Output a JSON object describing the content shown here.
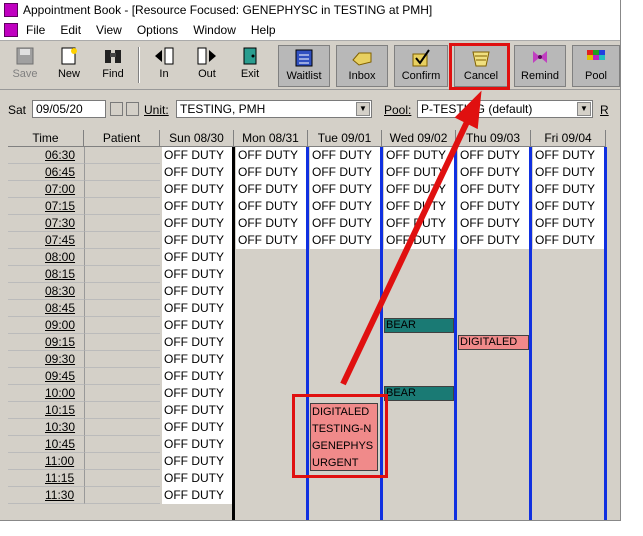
{
  "window": {
    "title": "Appointment Book - [Resource Focused:  GENEPHYSC in TESTING at PMH]"
  },
  "menu": [
    "File",
    "Edit",
    "View",
    "Options",
    "Window",
    "Help"
  ],
  "toolbar": {
    "save": "Save",
    "new": "New",
    "find": "Find",
    "in": "In",
    "out": "Out",
    "exit": "Exit",
    "waitlist": "Waitlist",
    "inbox": "Inbox",
    "confirm": "Confirm",
    "cancel": "Cancel",
    "remind": "Remind",
    "pool": "Pool"
  },
  "filter": {
    "day": "Sat",
    "date": "09/05/20",
    "unit_label": "Unit:",
    "unit_value": "TESTING, PMH",
    "pool_label": "Pool:",
    "pool_value": "P-TESTING (default)",
    "right_label": "R"
  },
  "columns": [
    "Time",
    "Patient",
    "Sun 08/30",
    "Mon 08/31",
    "Tue 09/01",
    "Wed 09/02",
    "Thu 09/03",
    "Fri 09/04"
  ],
  "times": [
    "06:30",
    "06:45",
    "07:00",
    "07:15",
    "07:30",
    "07:45",
    "08:00",
    "08:15",
    "08:30",
    "08:45",
    "09:00",
    "09:15",
    "09:30",
    "09:45",
    "10:00",
    "10:15",
    "10:30",
    "10:45",
    "11:00",
    "11:15",
    "11:30"
  ],
  "off_duty_label": "OFF DUTY",
  "appointments": [
    {
      "day": "Wed 09/02",
      "time": "09:00",
      "label": "BEAR",
      "color": "#1a7a74"
    },
    {
      "day": "Thu 09/03",
      "time": "09:15",
      "label": "DIGITALED",
      "color": "#f08a8a"
    },
    {
      "day": "Wed 09/02",
      "time": "10:00",
      "label": "BEAR",
      "color": "#1a7a74"
    },
    {
      "day": "Tue 09/01",
      "time": "10:15",
      "lines": [
        "DIGITALED",
        "TESTING-N",
        "GENEPHYS",
        "URGENT"
      ],
      "color": "#f08a8a"
    }
  ],
  "colors": {
    "annotation": "#e01010",
    "off_duty_bg": "#ffffff",
    "open_bg": "#d4d0c8",
    "day_line": "#1030e0",
    "sun_line": "#000000"
  }
}
